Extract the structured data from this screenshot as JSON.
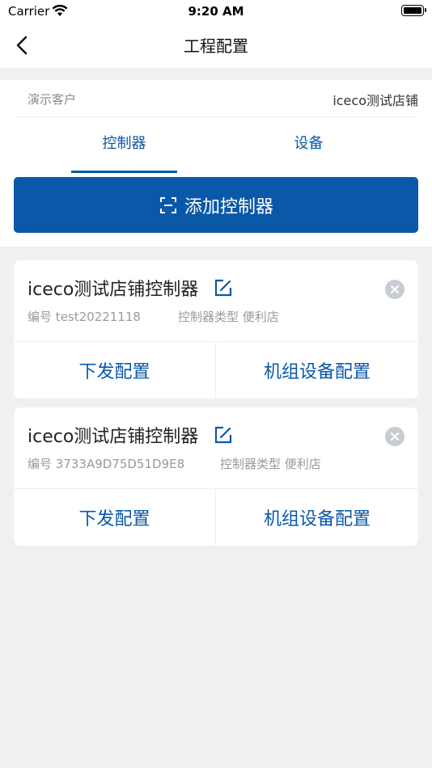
{
  "status_bar": {
    "carrier": "Carrier",
    "time": "9:20 AM"
  },
  "nav": {
    "title": "工程配置",
    "back_icon": "chevron-left-icon"
  },
  "customer": {
    "label": "演示客户",
    "value": "iceco测试店铺"
  },
  "tabs": [
    {
      "label": "控制器",
      "active": true
    },
    {
      "label": "设备",
      "active": false
    }
  ],
  "add_button": {
    "label": "添加控制器",
    "icon": "scan-icon"
  },
  "controllers": [
    {
      "name": "iceco测试店铺控制器",
      "id_text": "编号 test20221118",
      "type_text": "控制器类型 便利店",
      "action_send": "下发配置",
      "action_unit": "机组设备配置"
    },
    {
      "name": "iceco测试店铺控制器",
      "id_text": "编号 3733A9D75D51D9E8",
      "type_text": "控制器类型 便利店",
      "action_send": "下发配置",
      "action_unit": "机组设备配置"
    }
  ],
  "colors": {
    "accent": "#0a58a8",
    "background": "#f0f0f0"
  }
}
